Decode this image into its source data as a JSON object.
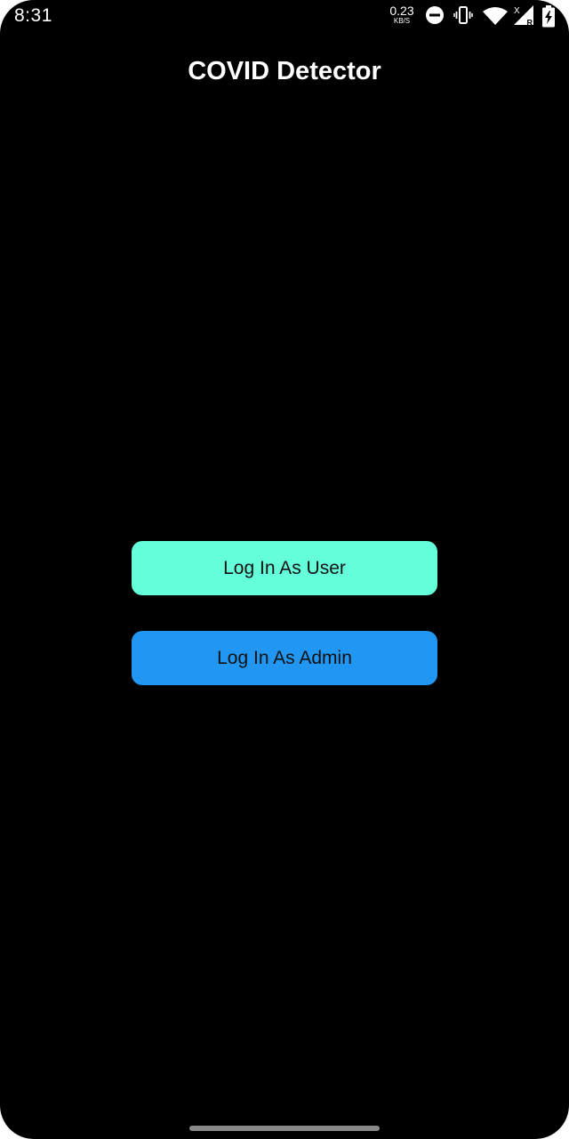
{
  "status_bar": {
    "time": "8:31",
    "net_speed_value": "0.23",
    "net_speed_unit": "KB/S",
    "network_badge": "X",
    "roaming_badge": "R",
    "icons": [
      "do-not-disturb-icon",
      "vibrate-icon",
      "wifi-icon",
      "cell-signal-icon",
      "battery-charging-icon"
    ]
  },
  "app": {
    "title": "COVID Detector"
  },
  "actions": {
    "user_login_label": "Log In As User",
    "admin_login_label": "Log In As Admin"
  },
  "colors": {
    "background": "#000000",
    "user_button": "#64ffda",
    "admin_button": "#2196f3",
    "text_light": "#ffffff",
    "text_dark": "#111111"
  }
}
